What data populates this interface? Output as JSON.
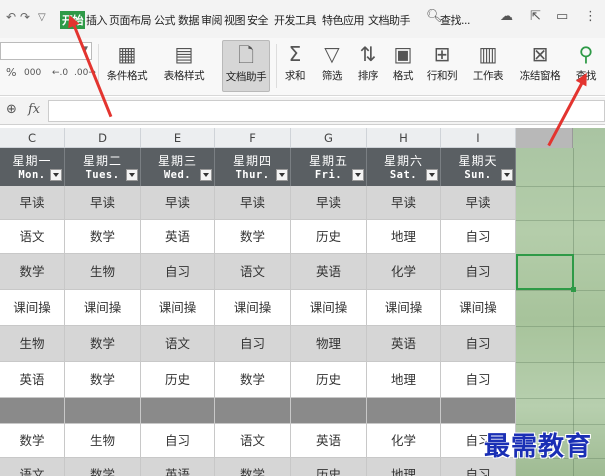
{
  "menubar": {
    "tabs": [
      "开始",
      "插入",
      "页面布局",
      "公式",
      "数据",
      "审阅",
      "视图",
      "安全",
      "开发工具",
      "特色应用",
      "文档助手"
    ],
    "active_tab": "开始",
    "search_label": "查找..."
  },
  "ribbon": {
    "font_name": "",
    "format_row": [
      "%",
      "000",
      "←.0",
      ".00→"
    ],
    "buttons": [
      {
        "label": "条件格式",
        "icon": "conditional-format-icon"
      },
      {
        "label": "表格样式",
        "icon": "table-style-icon"
      },
      {
        "label": "文档助手",
        "icon": "document-assistant-icon",
        "selected": true
      },
      {
        "label": "求和",
        "icon": "sum-icon"
      },
      {
        "label": "筛选",
        "icon": "filter-icon"
      },
      {
        "label": "排序",
        "icon": "sort-icon"
      },
      {
        "label": "格式",
        "icon": "format-icon"
      },
      {
        "label": "行和列",
        "icon": "rows-columns-icon"
      },
      {
        "label": "工作表",
        "icon": "worksheet-icon"
      },
      {
        "label": "冻结窗格",
        "icon": "freeze-panes-icon"
      },
      {
        "label": "查找",
        "icon": "find-icon"
      }
    ]
  },
  "formula_bar": {
    "fx": "fx",
    "value": ""
  },
  "columns": [
    "C",
    "D",
    "E",
    "F",
    "G",
    "H",
    "I",
    "J"
  ],
  "headers": [
    {
      "cn": "星期一",
      "en": "Mon."
    },
    {
      "cn": "星期二",
      "en": "Tues."
    },
    {
      "cn": "星期三",
      "en": "Wed."
    },
    {
      "cn": "星期四",
      "en": "Thur."
    },
    {
      "cn": "星期五",
      "en": "Fri."
    },
    {
      "cn": "星期六",
      "en": "Sat."
    },
    {
      "cn": "星期天",
      "en": "Sun."
    }
  ],
  "rows": [
    [
      "早读",
      "早读",
      "早读",
      "早读",
      "早读",
      "早读",
      "早读"
    ],
    [
      "语文",
      "数学",
      "英语",
      "数学",
      "历史",
      "地理",
      "自习"
    ],
    [
      "数学",
      "生物",
      "自习",
      "语文",
      "英语",
      "化学",
      "自习"
    ],
    [
      "课间操",
      "课间操",
      "课间操",
      "课间操",
      "课间操",
      "课间操",
      "课间操"
    ],
    [
      "生物",
      "数学",
      "语文",
      "自习",
      "物理",
      "英语",
      "自习"
    ],
    [
      "英语",
      "数学",
      "历史",
      "数学",
      "历史",
      "地理",
      "自习"
    ],
    [
      "",
      "",
      "",
      "",
      "",
      "",
      ""
    ],
    [
      "数学",
      "生物",
      "自习",
      "语文",
      "英语",
      "化学",
      "自习"
    ],
    [
      "语文",
      "数学",
      "英语",
      "数学",
      "历史",
      "地理",
      "自习"
    ]
  ],
  "watermark": "最需教育",
  "colors": {
    "accent": "#2e9a47",
    "header_bg": "#5a5f63",
    "arrow": "#e3342f",
    "watermark": "#1a2fb5"
  }
}
